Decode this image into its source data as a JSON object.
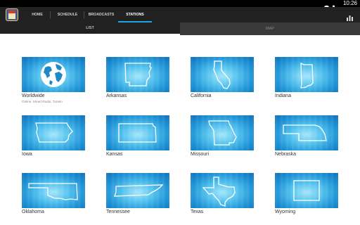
{
  "status_bar": {
    "time": "10:26"
  },
  "app": {
    "logo_icon": "radio-station-logo-icon",
    "tabs": [
      {
        "label": "HOME",
        "active": false
      },
      {
        "label": "SCHEDULE",
        "active": false
      },
      {
        "label": "BROADCASTS",
        "active": false
      },
      {
        "label": "STATIONS",
        "active": true
      }
    ],
    "action_icon": "bar-chart-icon"
  },
  "subtabs": [
    {
      "label": "LIST",
      "active": true
    },
    {
      "label": "MAP",
      "active": false
    }
  ],
  "stations": [
    {
      "name": "Worldwide",
      "sub": "Online, iHeart Radio, TuneIn",
      "icon": "globe-icon"
    },
    {
      "name": "Arkansas",
      "sub": "",
      "icon": "arkansas-outline-icon"
    },
    {
      "name": "California",
      "sub": "",
      "icon": "california-outline-icon"
    },
    {
      "name": "Indiana",
      "sub": "",
      "icon": "indiana-outline-icon"
    },
    {
      "name": "Iowa",
      "sub": "",
      "icon": "iowa-outline-icon"
    },
    {
      "name": "Kansas",
      "sub": "",
      "icon": "kansas-outline-icon"
    },
    {
      "name": "Missouri",
      "sub": "",
      "icon": "missouri-outline-icon"
    },
    {
      "name": "Nebraska",
      "sub": "",
      "icon": "nebraska-outline-icon"
    },
    {
      "name": "Oklahoma",
      "sub": "",
      "icon": "oklahoma-outline-icon"
    },
    {
      "name": "Tennessee",
      "sub": "",
      "icon": "tennessee-outline-icon"
    },
    {
      "name": "Texas",
      "sub": "",
      "icon": "texas-outline-icon"
    },
    {
      "name": "Wyoming",
      "sub": "",
      "icon": "wyoming-outline-icon"
    }
  ],
  "colors": {
    "appbar": "#212121",
    "accent": "#1da9e0",
    "tile": "#1e93d6"
  }
}
